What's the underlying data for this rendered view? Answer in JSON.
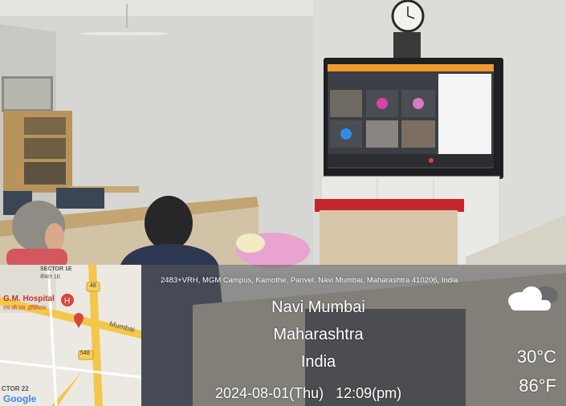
{
  "overlay": {
    "address": "2483+VRH, MGM Campus, Kamothe, Panvel, Navi Mumbai, Maharashtra 410206, India",
    "city": "Navi Mumbai",
    "state": "Maharashtra",
    "country": "India",
    "datetime": "2024-08-01(Thu)   12:09(pm)",
    "temp_c": "30°C",
    "temp_f": "86°F",
    "weather_icon": "cloud-icon"
  },
  "map": {
    "sector_top_en": "SECTOR 1E",
    "sector_top_hi": "सेक्टर 1E",
    "road_48": "48",
    "hospital_en": "G.M. Hospital",
    "hospital_hi": "एम.जी.एम. हॉस्पिटल",
    "road_name": "Mumbai",
    "road_548": "548",
    "sector_bottom": "CTOR 22",
    "logo": "Google",
    "pin_icon": "map-pin-icon"
  },
  "colors": {
    "overlay_text": "#ffffff",
    "map_road": "#f3c74a",
    "hospital_pin": "#d9453b",
    "logo_blue": "#4285f4"
  }
}
